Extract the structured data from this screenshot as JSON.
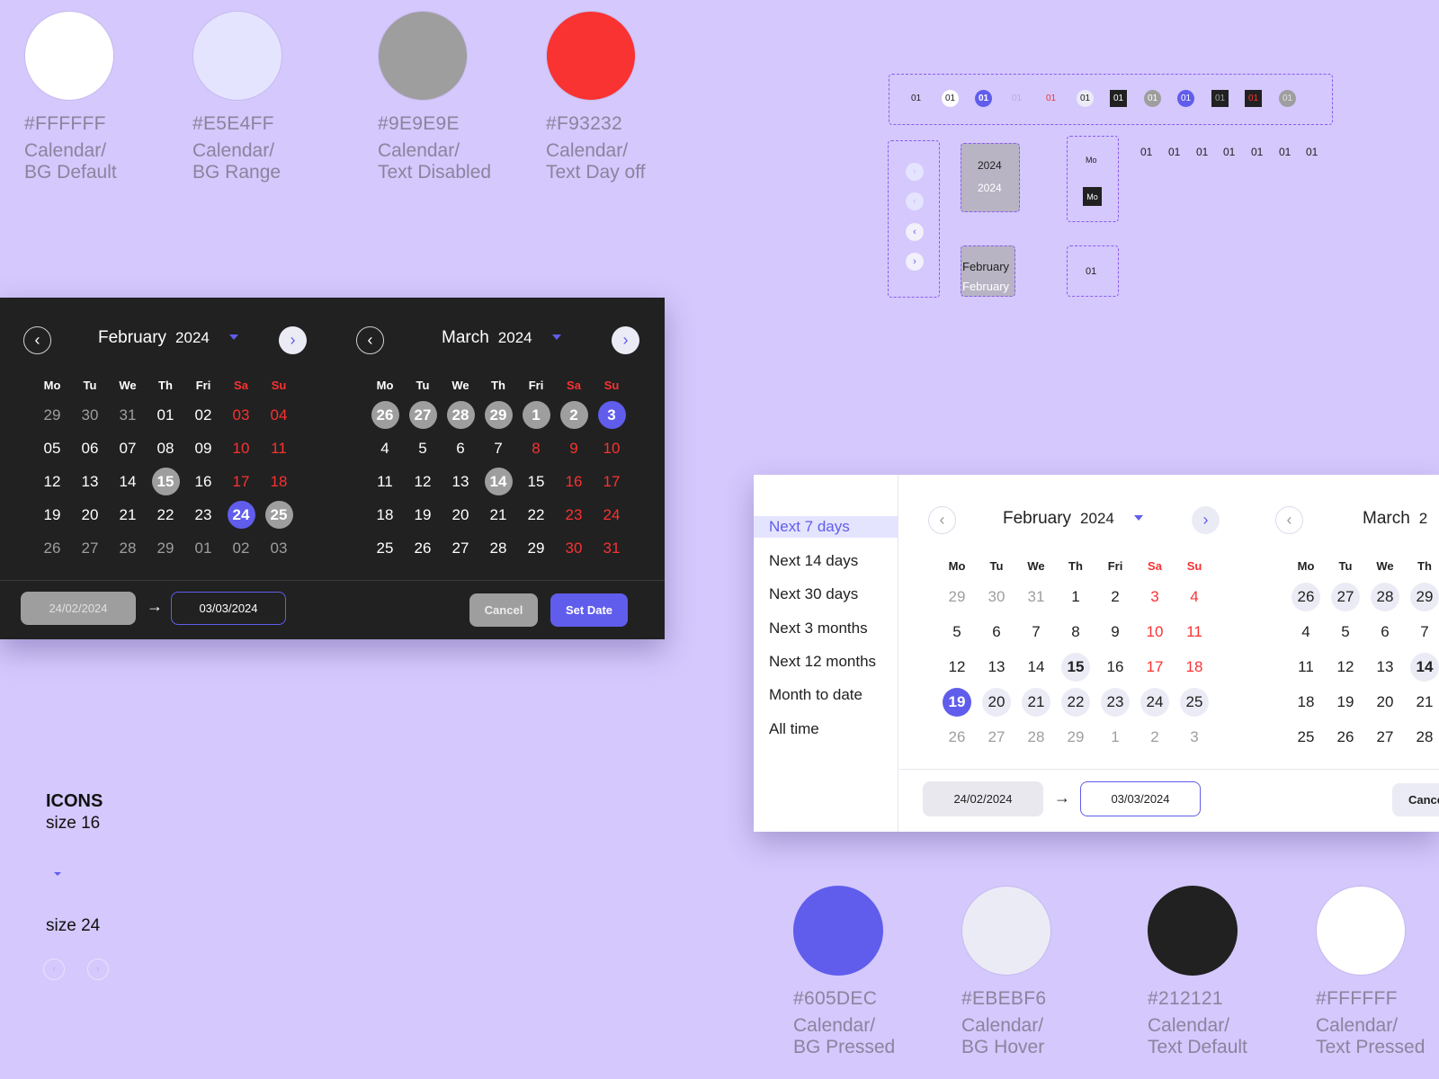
{
  "swatches_top": [
    {
      "hex": "#FFFFFF",
      "label": "Calendar/\nBG Default",
      "color": "#FFFFFF"
    },
    {
      "hex": "#E5E4FF",
      "label": "Calendar/\nBG Range",
      "color": "#E5E4FF"
    },
    {
      "hex": "#9E9E9E",
      "label": "Calendar/\nText Disabled",
      "color": "#9E9E9E"
    },
    {
      "hex": "#F93232",
      "label": "Calendar/\nText Day off",
      "color": "#F93232"
    }
  ],
  "swatches_bottom": [
    {
      "hex": "#605DEC",
      "label": "Calendar/\nBG Pressed",
      "color": "#605DEC"
    },
    {
      "hex": "#EBEBF6",
      "label": "Calendar/\nBG Hover",
      "color": "#EBEBF6"
    },
    {
      "hex": "#212121",
      "label": "Calendar/\nText Default",
      "color": "#212121"
    },
    {
      "hex": "#FFFFFF",
      "label": "Calendar/\nText Pressed",
      "color": "#FFFFFF"
    }
  ],
  "weekday_names": [
    "Mo",
    "Tu",
    "We",
    "Th",
    "Fri",
    "Sa",
    "Su"
  ],
  "dark_calendar": {
    "left_month": "February",
    "left_year": "2024",
    "right_month": "March",
    "right_year": "2024",
    "start_date": "24/02/2024",
    "end_date": "03/03/2024",
    "cancel_label": "Cancel",
    "set_label": "Set Date"
  },
  "light_calendar": {
    "left_month": "February",
    "left_year": "2024",
    "right_month": "March",
    "right_year": "2",
    "start_date": "24/02/2024",
    "end_date": "03/03/2024",
    "cancel_label": "Cance",
    "presets": [
      "Next 7 days",
      "Next 14 days",
      "Next 30 days",
      "Next 3 months",
      "Next 12  months",
      "Month to date",
      "All time"
    ]
  },
  "sheet": {
    "chip_text": "01",
    "year_text": "2024",
    "month_text": "February",
    "weekday_text": "Mo",
    "cell_text": "01"
  },
  "icons": {
    "title": "ICONS",
    "size16": "size 16",
    "size24": "size 24"
  }
}
